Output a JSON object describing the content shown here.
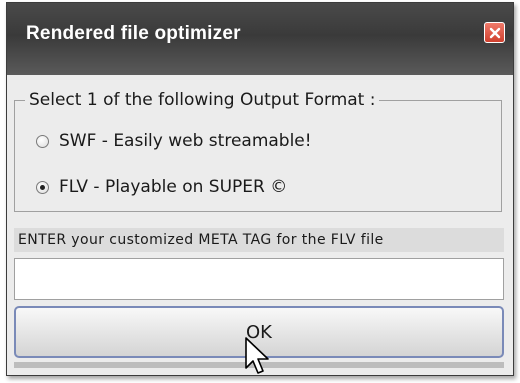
{
  "window": {
    "title": "Rendered file optimizer",
    "close_icon": "close-x-icon"
  },
  "output_format": {
    "legend": "Select 1 of the following Output Format :",
    "options": [
      {
        "label": "SWF - Easily web streamable!",
        "selected": false
      },
      {
        "label": "FLV - Playable on SUPER ©",
        "selected": true
      }
    ]
  },
  "meta_tag": {
    "label": "ENTER your customized META TAG for the FLV file",
    "value": ""
  },
  "ok_button": {
    "label": "OK"
  },
  "colors": {
    "title_bar": "#3a3a3a",
    "close_button": "#d0402e",
    "ok_border": "#7a8ab8"
  }
}
